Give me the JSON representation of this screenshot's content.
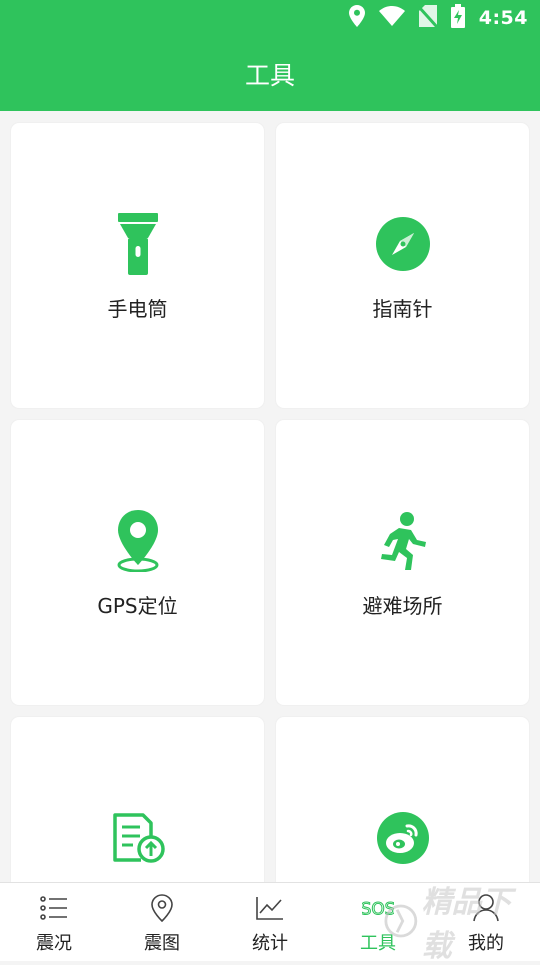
{
  "status_bar": {
    "time": "4:54",
    "icons": [
      "location-icon",
      "wifi-icon",
      "no-sim-icon",
      "battery-charging-icon"
    ]
  },
  "header": {
    "title": "工具"
  },
  "tools": [
    {
      "label": "手电筒",
      "icon": "flashlight-icon"
    },
    {
      "label": "指南针",
      "icon": "compass-icon"
    },
    {
      "label": "GPS定位",
      "icon": "map-pin-icon"
    },
    {
      "label": "避难场所",
      "icon": "running-person-icon"
    },
    {
      "label": "",
      "icon": "report-upload-icon"
    },
    {
      "label": "",
      "icon": "weibo-icon"
    }
  ],
  "tabbar": {
    "items": [
      {
        "label": "震况",
        "icon": "list-icon",
        "active": false
      },
      {
        "label": "震图",
        "icon": "location-pin-outline-icon",
        "active": false
      },
      {
        "label": "统计",
        "icon": "line-chart-icon",
        "active": false
      },
      {
        "label": "工具",
        "icon": "sos-icon",
        "active": true
      },
      {
        "label": "我的",
        "icon": "user-icon",
        "active": false
      }
    ]
  },
  "colors": {
    "accent": "#2fc35c",
    "background": "#f4f4f4",
    "card": "#ffffff",
    "text": "#222222"
  }
}
